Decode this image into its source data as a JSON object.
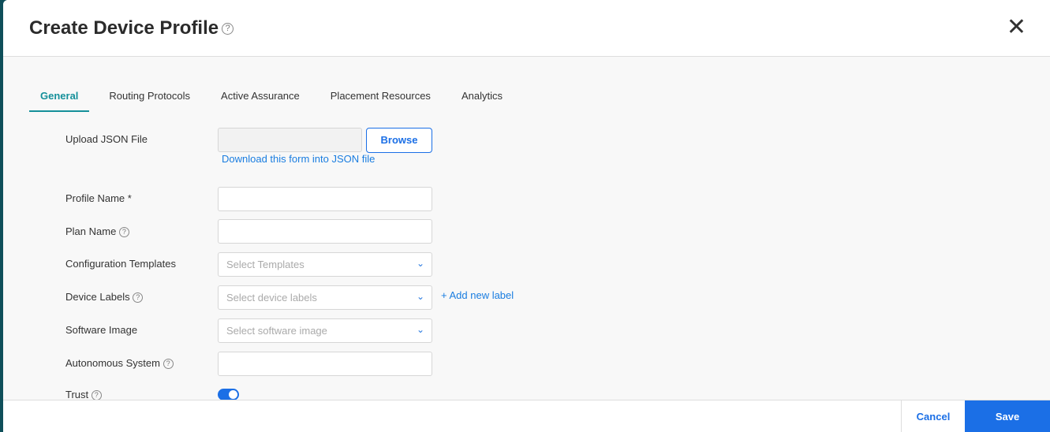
{
  "header": {
    "title": "Create Device Profile",
    "help": "?",
    "close": "✕"
  },
  "tabs": [
    {
      "label": "General",
      "active": true
    },
    {
      "label": "Routing Protocols"
    },
    {
      "label": "Active Assurance"
    },
    {
      "label": "Placement Resources"
    },
    {
      "label": "Analytics"
    }
  ],
  "form": {
    "upload_label": "Upload JSON File",
    "browse": "Browse",
    "download_link": "Download this form into JSON file",
    "profile_name_label": "Profile Name *",
    "profile_name_value": "",
    "plan_name_label": "Plan Name",
    "plan_name_value": "",
    "config_templates_label": "Configuration Templates",
    "config_templates_placeholder": "Select Templates",
    "device_labels_label": "Device Labels",
    "device_labels_placeholder": "Select device labels",
    "add_label": "+ Add new label",
    "software_image_label": "Software Image",
    "software_image_placeholder": "Select software image",
    "as_label": "Autonomous System",
    "as_value": "",
    "trust_label": "Trust",
    "trust_on": true
  },
  "footer": {
    "cancel": "Cancel",
    "save": "Save"
  },
  "colors": {
    "accent": "#15909a",
    "primary": "#1b6fe6"
  }
}
